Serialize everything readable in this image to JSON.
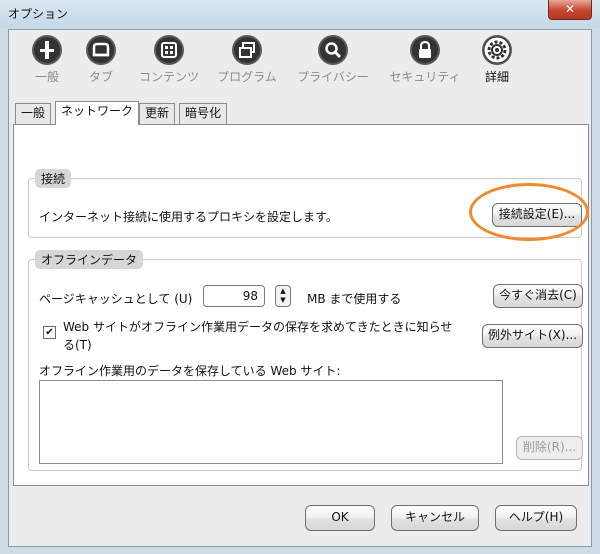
{
  "window": {
    "title": "オプション",
    "close_glyph": "✕"
  },
  "toolbar": {
    "items": [
      {
        "label": "一般",
        "icon": "switch-icon"
      },
      {
        "label": "タブ",
        "icon": "tab-icon"
      },
      {
        "label": "コンテンツ",
        "icon": "content-icon"
      },
      {
        "label": "プログラム",
        "icon": "programs-icon"
      },
      {
        "label": "プライバシー",
        "icon": "privacy-icon"
      },
      {
        "label": "セキュリティ",
        "icon": "lock-icon"
      },
      {
        "label": "詳細",
        "icon": "gear-icon",
        "active": true
      }
    ]
  },
  "tabs": [
    {
      "label": "一般"
    },
    {
      "label": "ネットワーク",
      "active": true
    },
    {
      "label": "更新"
    },
    {
      "label": "暗号化"
    }
  ],
  "connection": {
    "heading": "接続",
    "description": "インターネット接続に使用するプロキシを設定します。",
    "settings_button": "接続設定(E)..."
  },
  "offline": {
    "heading": "オフラインデータ",
    "cache_label": "ページキャッシュとして (U)",
    "cache_value": "98",
    "cache_unit": "MB まで使用する",
    "clear_button": "今すぐ消去(C)",
    "notify_label_line1": "Web サイトがオフライン作業用データの保存を求めてきたときに知らせ",
    "notify_label_line2": "る(T)",
    "notify_checked": true,
    "exceptions_button": "例外サイト(X)...",
    "sites_label": "オフライン作業用のデータを保存している Web サイト:",
    "delete_button": "削除(R)..."
  },
  "footer": {
    "ok": "OK",
    "cancel": "キャンセル",
    "help": "ヘルプ(H)"
  },
  "colors": {
    "highlight": "#f08a2e",
    "titlebar": "#cfdde9",
    "close": "#c8452d"
  }
}
